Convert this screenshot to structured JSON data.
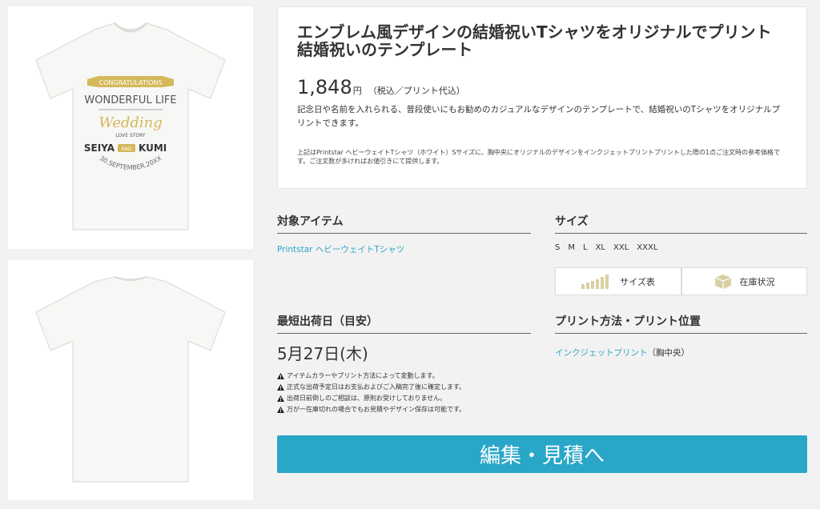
{
  "product": {
    "title": "エンブレム風デザインの結婚祝いTシャツをオリジナルでプリント　結婚祝いのテンプレート",
    "price": "1,848",
    "price_unit": "円",
    "price_note": "（税込／プリント代込）",
    "description": "記念日や名前を入れられる、普段使いにもお勧めのカジュアルなデザインのテンプレートで、結婚祝いのTシャツをオリジナルプリントできます。",
    "fine_print": "上記はPrintstar ヘビーウェイトTシャツ（ホワイト）Sサイズに、胸中央にオリジナルのデザインをインクジェットプリントプリントした際の1点ご注文時の参考価格です。ご注文数が多ければお値引きにて提供します。"
  },
  "shirt_design": {
    "banner": "CONGRATULATIONS",
    "line1": "WONDERFUL LIFE",
    "script": "Wedding",
    "sub": "LOVE STORY",
    "name1": "SEIYA",
    "and": "AND",
    "name2": "KUMI",
    "date": "30.SEPTEMBER.20XX"
  },
  "target_item": {
    "heading": "対象アイテム",
    "link": "Printstar ヘビーウェイトTシャツ"
  },
  "size": {
    "heading": "サイズ",
    "sizes": [
      "S",
      "M",
      "L",
      "XL",
      "XXL",
      "XXXL"
    ],
    "size_chart_label": "サイズ表",
    "stock_label": "在庫状況"
  },
  "shipping": {
    "heading": "最短出荷日（目安）",
    "date": "5月27日(木)",
    "notes": [
      "アイテムカラーやプリント方法によって変動します。",
      "正式な出荷予定日はお支払およびご入稿完了後に確定します。",
      "出荷日前倒しのご相談は、原則お受けしておりません。",
      "万が一在庫切れの場合でもお見積やデザイン保存は可能です。"
    ]
  },
  "print": {
    "heading": "プリント方法・プリント位置",
    "method": "インクジェットプリント",
    "position": "（胸中央）"
  },
  "cta": {
    "label": "編集・見積へ"
  },
  "colors": {
    "accent": "#2aa6c8",
    "link": "#2aa4c8",
    "gold": "#d4b85a"
  }
}
